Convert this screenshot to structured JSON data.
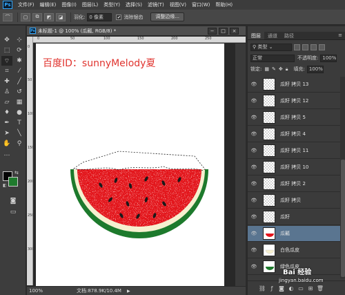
{
  "app": {
    "logo": "Ps"
  },
  "menu": [
    "文件(F)",
    "编辑(E)",
    "图像(I)",
    "图层(L)",
    "类型(Y)",
    "选择(S)",
    "滤镜(T)",
    "视图(V)",
    "窗口(W)",
    "帮助(H)"
  ],
  "options": {
    "feather_label": "羽化:",
    "feather_value": "0 像素",
    "antialias_label": "消除锯齿",
    "antialias_checked": "✔",
    "refine_edge_label": "调整边缘..."
  },
  "document": {
    "title": "未标题-1 @ 100% (瓜瓤, RGB/8) *",
    "watermark": "百度ID：sunnyMelody夏",
    "zoom": "100%",
    "doc_size": "文档:878.9K/10.4M",
    "ruler_top": [
      "0",
      "50",
      "100",
      "150",
      "200",
      "250"
    ],
    "ruler_left": [
      "0",
      "50",
      "100",
      "150",
      "200",
      "250",
      "300"
    ]
  },
  "tools": {
    "icons": [
      "move-tool",
      "marquee-tool",
      "lasso-tool",
      "magic-wand-tool",
      "crop-tool",
      "eyedropper-tool",
      "healing-brush-tool",
      "brush-tool",
      "clone-stamp-tool",
      "history-brush-tool",
      "eraser-tool",
      "gradient-tool",
      "blur-tool",
      "dodge-tool",
      "pen-tool",
      "type-tool",
      "path-selection-tool",
      "shape-tool",
      "hand-tool",
      "zoom-tool"
    ],
    "foreground_color": "#050505",
    "background_color": "#1f7a2d"
  },
  "layers_panel": {
    "tabs": [
      "图层",
      "通道",
      "路径"
    ],
    "filter_label": "类型",
    "blend_mode": "正常",
    "opacity_label": "不透明度:",
    "opacity_value": "100%",
    "lock_label": "锁定:",
    "fill_label": "填充:",
    "fill_value": "100%",
    "layers": [
      {
        "name": "瓜籽 拷贝 13",
        "selected": false
      },
      {
        "name": "瓜籽 拷贝 12",
        "selected": false
      },
      {
        "name": "瓜籽 拷贝 5",
        "selected": false
      },
      {
        "name": "瓜籽 拷贝 4",
        "selected": false
      },
      {
        "name": "瓜籽 拷贝 11",
        "selected": false
      },
      {
        "name": "瓜籽 拷贝 10",
        "selected": false
      },
      {
        "name": "瓜籽 拷贝 2",
        "selected": false
      },
      {
        "name": "瓜籽 拷贝",
        "selected": false
      },
      {
        "name": "瓜籽",
        "selected": false
      },
      {
        "name": "瓜瓤",
        "selected": true
      },
      {
        "name": "白色瓜皮",
        "selected": false
      },
      {
        "name": "绿色瓜皮",
        "selected": false
      }
    ]
  },
  "branding": {
    "name": "Bai 经验",
    "url": "jingyan.baidu.com"
  }
}
